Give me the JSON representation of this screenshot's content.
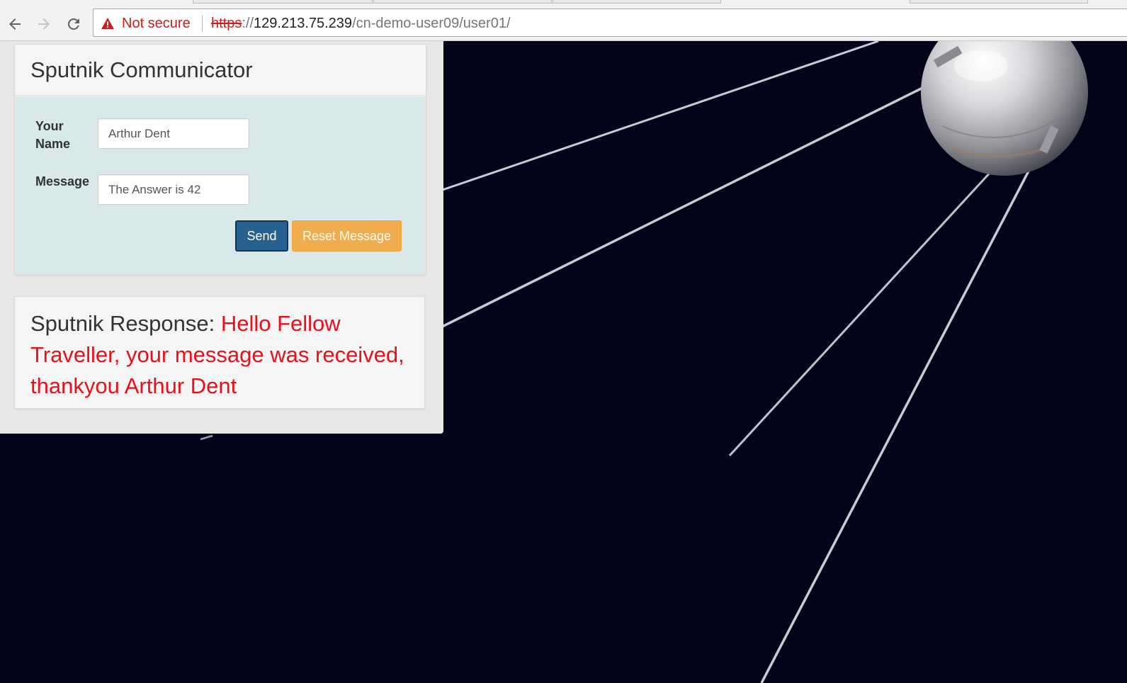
{
  "browser": {
    "back_icon": "arrow-left-icon",
    "forward_icon": "arrow-right-icon",
    "reload_icon": "reload-icon",
    "security_icon": "warning-triangle-icon",
    "security_label": "Not secure",
    "url_scheme": "https",
    "url_separator": "://",
    "url_host": "129.213.75.239",
    "url_path": "/cn-demo-user09/user01/"
  },
  "communicator": {
    "title": "Sputnik Communicator",
    "name_label_line1": "Your",
    "name_label_line2": "Name",
    "name_value": "Arthur Dent",
    "message_label": "Message",
    "message_value": "The Answer is 42",
    "send_label": "Send",
    "reset_label": "Reset Message"
  },
  "response": {
    "prefix": "Sputnik Response: ",
    "message": "Hello Fellow Traveller, your message was received, thankyou Arthur Dent"
  },
  "colors": {
    "background": "#03031a",
    "send_button": "#286090",
    "reset_button": "#f0ad4e",
    "response_text": "#e8111b",
    "not_secure": "#c5221f"
  }
}
